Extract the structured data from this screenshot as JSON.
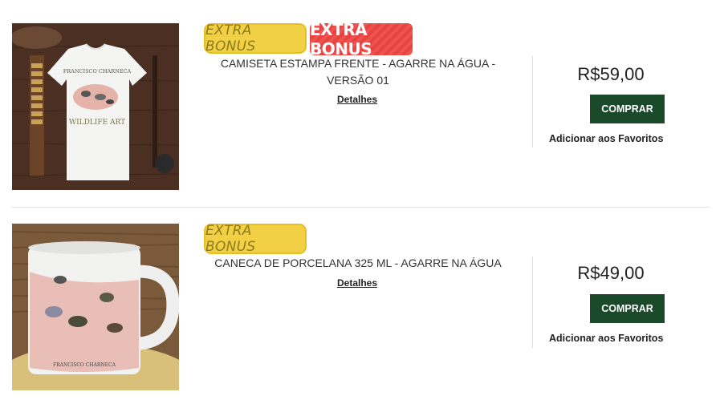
{
  "products": [
    {
      "badges": [
        "EXTRA BONUS",
        "EXTRA BONUS"
      ],
      "title": "CAMISETA ESTAMPA FRENTE - AGARRE NA ÁGUA - VERSÃO 01",
      "details_label": "Detalhes",
      "price": "R$59,00",
      "buy_label": "COMPRAR",
      "favorite_label": "Adicionar aos Favoritos",
      "image_text": {
        "brand": "FRANCISCO CHARNECA",
        "tagline": "WILDLIFE ART"
      }
    },
    {
      "badges": [
        "EXTRA BONUS"
      ],
      "title": "CANECA DE PORCELANA 325 ML - AGARRE NA ÁGUA",
      "details_label": "Detalhes",
      "price": "R$49,00",
      "buy_label": "COMPRAR",
      "favorite_label": "Adicionar aos Favoritos",
      "image_text": {
        "brand": "FRANCISCO CHARNECA"
      }
    }
  ],
  "colors": {
    "buy_button": "#1b4a2a",
    "badge_yellow": "#f2d046",
    "badge_red": "#f0534f"
  }
}
